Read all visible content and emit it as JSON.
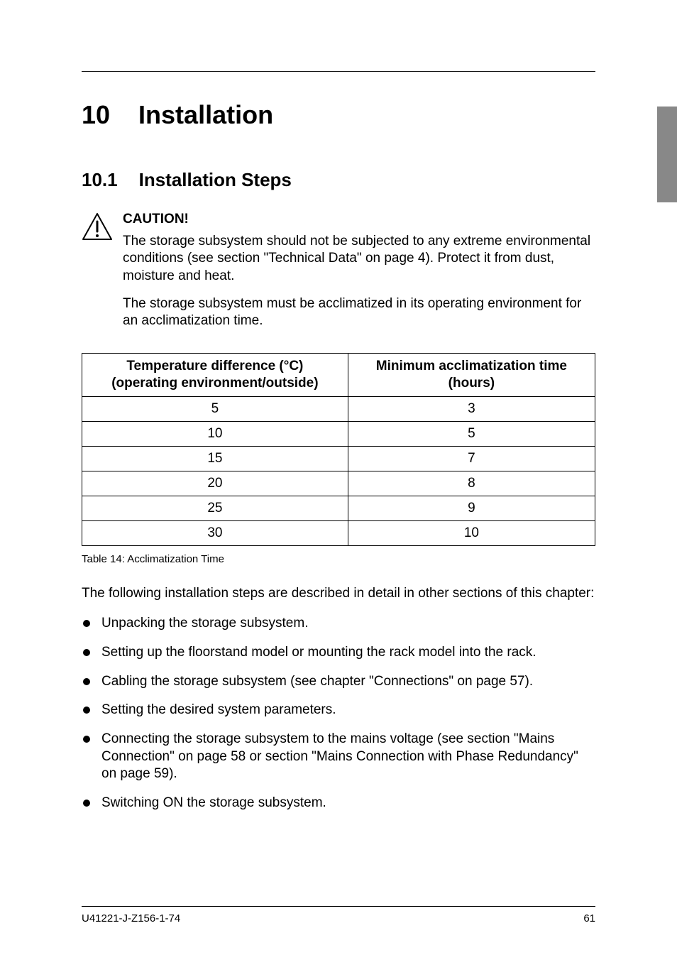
{
  "chapter": {
    "number": "10",
    "title": "Installation"
  },
  "section": {
    "number": "10.1",
    "title": "Installation Steps"
  },
  "caution": {
    "label": "CAUTION!",
    "para1": "The storage subsystem should not be subjected to any extreme environmental conditions (see section \"Technical Data\" on page 4). Protect it from dust, moisture and heat.",
    "para2": "The storage subsystem must be acclimatized in its operating environment for an acclimatization time."
  },
  "chart_data": {
    "type": "table",
    "title": "Acclimatization Time",
    "columns": [
      "Temperature difference (°C) (operating environment/outside)",
      "Minimum acclimatization time (hours)"
    ],
    "rows": [
      {
        "temp": "5",
        "hours": "3"
      },
      {
        "temp": "10",
        "hours": "5"
      },
      {
        "temp": "15",
        "hours": "7"
      },
      {
        "temp": "20",
        "hours": "8"
      },
      {
        "temp": "25",
        "hours": "9"
      },
      {
        "temp": "30",
        "hours": "10"
      }
    ]
  },
  "table_header": {
    "col1_line1": "Temperature difference (°C)",
    "col1_line2": "(operating environment/outside)",
    "col2_line1": "Minimum acclimatization time",
    "col2_line2": "(hours)"
  },
  "table_caption": "Table 14:  Acclimatization Time",
  "steps_intro": "The following installation steps are described in detail in other sections of this chapter:",
  "steps": [
    "Unpacking the storage subsystem.",
    "Setting up the floorstand model or mounting the rack model into the rack.",
    "Cabling the storage subsystem (see chapter \"Connections\" on page 57).",
    "Setting the desired system parameters.",
    "Connecting the storage subsystem to the mains voltage (see section \"Mains Connection\" on page 58 or section \"Mains Connection with Phase Redundancy\" on page 59).",
    "Switching ON the storage subsystem."
  ],
  "footer": {
    "left": "U41221-J-Z156-1-74",
    "right": "61"
  }
}
